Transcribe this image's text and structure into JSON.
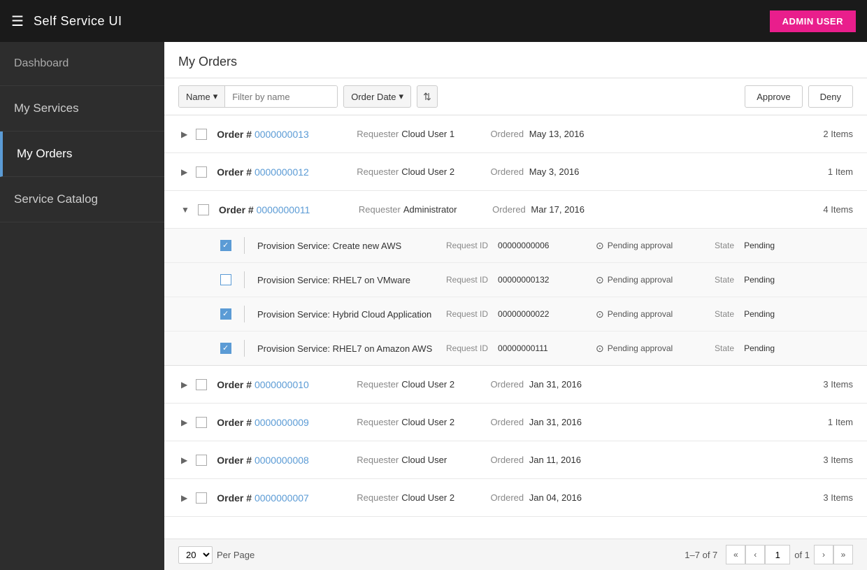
{
  "header": {
    "hamburger": "☰",
    "title": "Self Service UI",
    "admin_label": "ADMIN USER"
  },
  "sidebar": {
    "items": [
      {
        "id": "dashboard",
        "label": "Dashboard",
        "active": false
      },
      {
        "id": "my-services",
        "label": "My Services",
        "active": false
      },
      {
        "id": "my-orders",
        "label": "My Orders",
        "active": true
      },
      {
        "id": "service-catalog",
        "label": "Service Catalog",
        "active": false
      }
    ]
  },
  "page": {
    "title": "My Orders"
  },
  "toolbar": {
    "filter_label": "Name",
    "filter_placeholder": "Filter by name",
    "order_date_label": "Order Date",
    "sort_icon": "⇅",
    "approve_label": "Approve",
    "deny_label": "Deny"
  },
  "orders": [
    {
      "id": "order-13",
      "number": "0000000013",
      "requester": "Cloud User 1",
      "ordered_date": "May 13, 2016",
      "items_count": "2 Items",
      "expanded": false,
      "sub_items": []
    },
    {
      "id": "order-12",
      "number": "0000000012",
      "requester": "Cloud User 2",
      "ordered_date": "May 3, 2016",
      "items_count": "1 Item",
      "expanded": false,
      "sub_items": []
    },
    {
      "id": "order-11",
      "number": "0000000011",
      "requester": "Administrator",
      "ordered_date": "Mar 17, 2016",
      "items_count": "4 Items",
      "expanded": true,
      "sub_items": [
        {
          "name": "Provision Service: Create new AWS",
          "request_id": "00000000006",
          "approval_status": "Pending approval",
          "state": "Pending",
          "checked": true
        },
        {
          "name": "Provision Service: RHEL7 on VMware",
          "request_id": "00000000132",
          "approval_status": "Pending approval",
          "state": "Pending",
          "checked": false
        },
        {
          "name": "Provision Service: Hybrid Cloud Application",
          "request_id": "00000000022",
          "approval_status": "Pending approval",
          "state": "Pending",
          "checked": true
        },
        {
          "name": "Provision Service: RHEL7 on Amazon AWS",
          "request_id": "00000000111",
          "approval_status": "Pending approval",
          "state": "Pending",
          "checked": true
        }
      ]
    },
    {
      "id": "order-10",
      "number": "0000000010",
      "requester": "Cloud User 2",
      "ordered_date": "Jan 31, 2016",
      "items_count": "3 Items",
      "expanded": false,
      "sub_items": []
    },
    {
      "id": "order-9",
      "number": "0000000009",
      "requester": "Cloud User 2",
      "ordered_date": "Jan 31, 2016",
      "items_count": "1 Item",
      "expanded": false,
      "sub_items": []
    },
    {
      "id": "order-8",
      "number": "0000000008",
      "requester": "Cloud User",
      "ordered_date": "Jan 11, 2016",
      "items_count": "3 Items",
      "expanded": false,
      "sub_items": []
    },
    {
      "id": "order-7",
      "number": "0000000007",
      "requester": "Cloud User 2",
      "ordered_date": "Jan 04, 2016",
      "items_count": "3 Items",
      "expanded": false,
      "sub_items": []
    }
  ],
  "labels": {
    "requester": "Requester",
    "ordered": "Ordered",
    "request_id": "Request ID",
    "state": "State",
    "per_page": "Per Page",
    "order_hash": "Order #"
  },
  "pagination": {
    "per_page": "20",
    "range": "1–7 of 7",
    "current_page": "1",
    "total_pages": "1"
  }
}
